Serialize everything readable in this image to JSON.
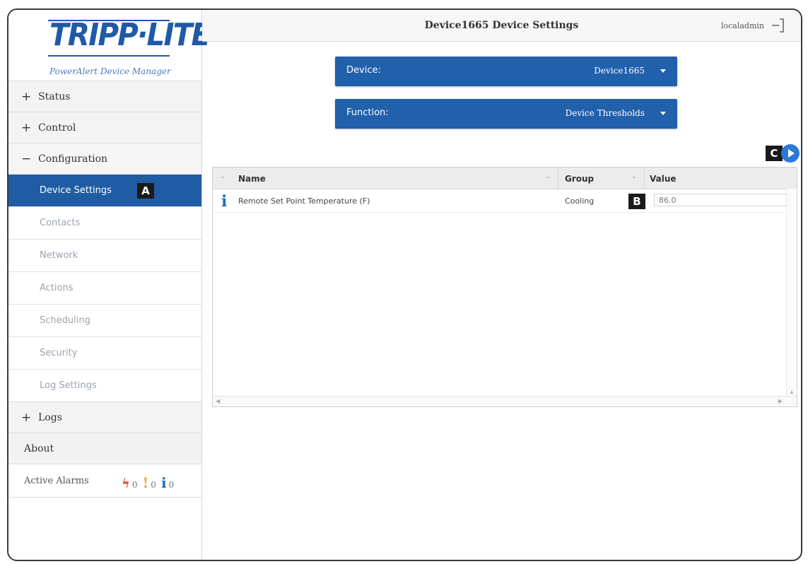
{
  "brand": {
    "logo_text": "TRIPP·LITE",
    "subtitle": "PowerAlert Device Manager",
    "color": "#1f5aa8"
  },
  "sidebar": {
    "sections": [
      {
        "symbol": "+",
        "label": "Status"
      },
      {
        "symbol": "+",
        "label": "Control"
      },
      {
        "symbol": "−",
        "label": "Configuration"
      }
    ],
    "config_items": [
      {
        "label": "Device Settings",
        "active": true,
        "badge": "A"
      },
      {
        "label": "Contacts"
      },
      {
        "label": "Network"
      },
      {
        "label": "Actions"
      },
      {
        "label": "Scheduling"
      },
      {
        "label": "Security"
      },
      {
        "label": "Log Settings"
      }
    ],
    "logs": {
      "symbol": "+",
      "label": "Logs"
    },
    "about": "About",
    "alarms": {
      "label": "Active Alarms",
      "critical_count": "0",
      "warning_count": "0",
      "info_count": "0",
      "icons": [
        "bolt-icon",
        "warning-icon",
        "info-icon"
      ]
    },
    "active_color": "#1f5ca4"
  },
  "header": {
    "title": "Device1665 Device Settings",
    "user": "localadmin",
    "logout_icon": "logout-icon"
  },
  "selectors": {
    "device": {
      "label": "Device:",
      "value": "Device1665"
    },
    "function": {
      "label": "Function:",
      "value": "Device Thresholds"
    },
    "color": "#2160ab"
  },
  "callouts": {
    "c": "C",
    "b": "B"
  },
  "table": {
    "columns": [
      "Name",
      "Group",
      "Value"
    ],
    "rows": [
      {
        "name": "Remote Set Point Temperature (F)",
        "group": "Cooling",
        "value": "86.0"
      }
    ]
  }
}
